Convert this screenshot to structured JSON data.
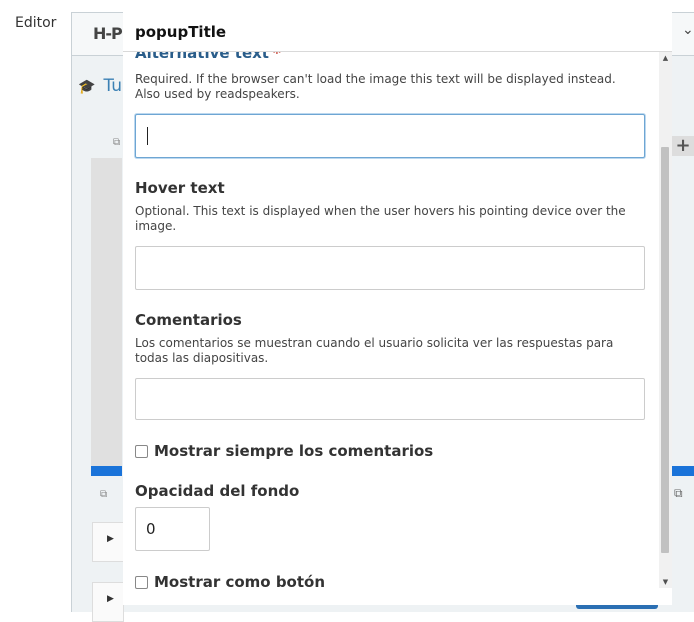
{
  "page": {
    "editor_label": "Editor"
  },
  "background": {
    "logo_text": "H-P",
    "tab_label": "Tu",
    "dropdown_glyph": "❯"
  },
  "popup": {
    "title": "popupTitle",
    "fields": {
      "alt_text": {
        "label": "Alternative text",
        "required_mark": "*",
        "description": "Required. If the browser can't load the image this text will be displayed instead. Also used by readspeakers.",
        "value": ""
      },
      "hover_text": {
        "label": "Hover text",
        "description": "Optional. This text is displayed when the user hovers his pointing device over the image.",
        "value": ""
      },
      "comments": {
        "label": "Comentarios",
        "description": "Los comentarios se muestran cuando el usuario solicita ver las respuestas para todas las diapositivas.",
        "value": ""
      },
      "always_show_comments": {
        "label": "Mostrar siempre los comentarios",
        "checked": false
      },
      "background_opacity": {
        "label": "Opacidad del fondo",
        "value": "0"
      },
      "show_as_button": {
        "label": "Mostrar como botón",
        "checked": false
      }
    }
  },
  "colors": {
    "accent_blue": "#1a73d9",
    "label_blue": "#2a5d8a",
    "required_red": "#c0392b",
    "focus_border": "#6ea6d3"
  }
}
